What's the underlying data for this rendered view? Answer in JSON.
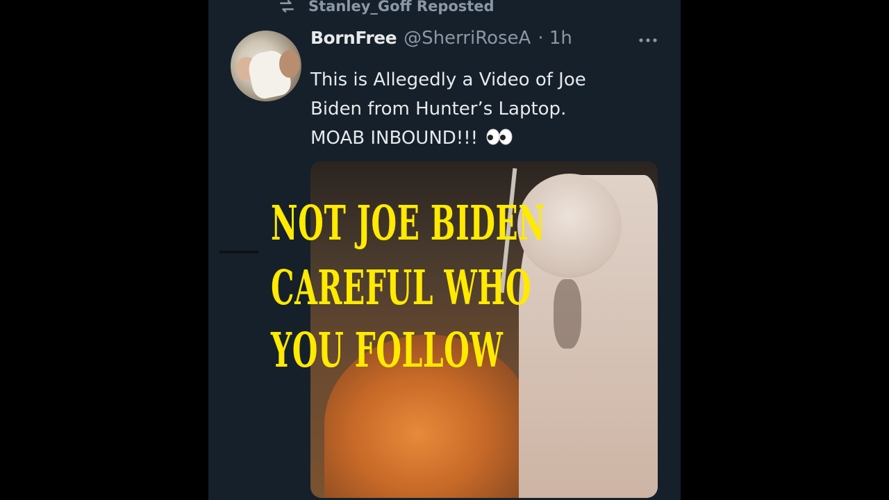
{
  "repost": {
    "icon": "repost-icon",
    "label": "Stanley_Goff Reposted"
  },
  "tweet": {
    "display_name": "BornFree",
    "handle": "@SherriRoseA",
    "time": "· 1h",
    "more_icon": "more-horizontal-icon",
    "text_lines": [
      "This is Allegedly a Video of Joe",
      "Biden from Hunter’s Laptop.",
      "MOAB INBOUND!!!"
    ],
    "emoji_icon": "eyes-emoji-icon"
  },
  "overlay": {
    "lines": [
      "NOT JOE BIDEN",
      "CAREFUL WHO",
      "YOU FOLLOW"
    ],
    "color": "#ffea00"
  },
  "colors": {
    "background": "#000000",
    "panel": "#15202b",
    "primary_text": "#e7e9ea",
    "secondary_text": "#8b98a5"
  }
}
